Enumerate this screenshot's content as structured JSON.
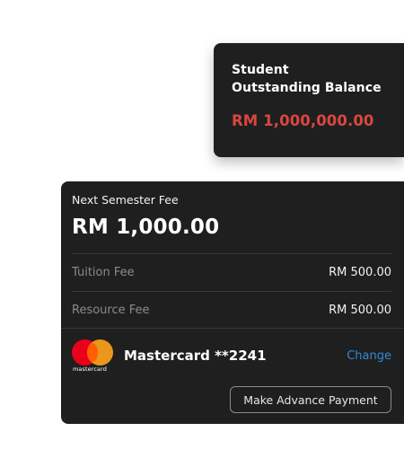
{
  "balance_card": {
    "title_line1": "Student",
    "title_line2": "Outstanding Balance",
    "amount": "RM 1,000,000.00"
  },
  "fee_card": {
    "header_label": "Next Semester Fee",
    "total": "RM 1,000.00",
    "items": [
      {
        "label": "Tuition Fee",
        "value": "RM 500.00"
      },
      {
        "label": "Resource Fee",
        "value": "RM 500.00"
      }
    ],
    "payment_method": {
      "brand_wordmark": "mastercard",
      "card_name": "Mastercard **2241",
      "change_label": "Change"
    },
    "advance_button_label": "Make Advance Payment"
  },
  "colors": {
    "card_background": "#1f1f1f",
    "balance_amount": "#d9473f",
    "link": "#2e8bd6",
    "mastercard_red": "#eb001b",
    "mastercard_orange": "#f79e1b"
  }
}
